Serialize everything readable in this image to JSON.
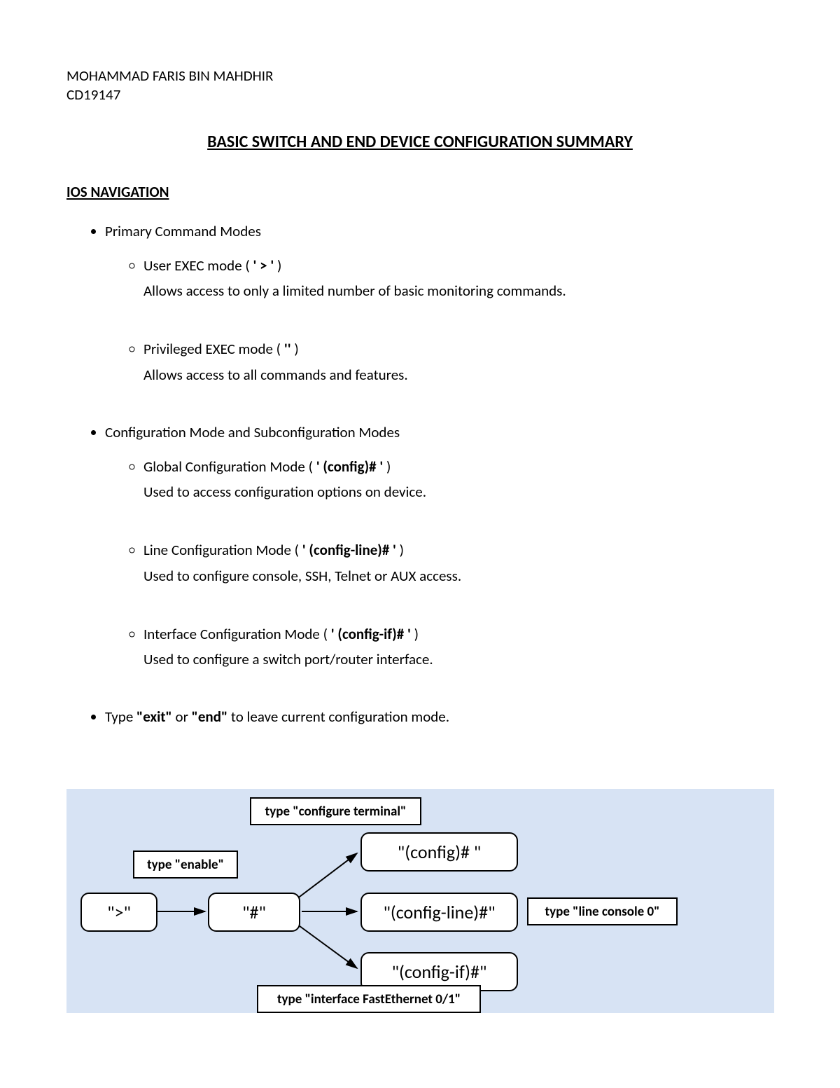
{
  "header": {
    "name": "MOHAMMAD FARIS BIN MAHDHIR",
    "id": "CD19147"
  },
  "title": "BASIC SWITCH AND END DEVICE CONFIGURATION SUMMARY",
  "section_heading": "IOS NAVIGATION",
  "bullets": {
    "primary": {
      "title": "Primary Command Modes",
      "items": [
        {
          "head_pre": "User EXEC mode ( ",
          "head_bold": "' > '",
          "head_post": " )",
          "desc": "Allows access to only a limited number of basic monitoring commands."
        },
        {
          "head_pre": "Privileged EXEC mode ( ",
          "head_bold": "''",
          "head_post": " )",
          "desc": "Allows access to all commands and features."
        }
      ]
    },
    "config": {
      "title": "Configuration Mode and Subconfiguration Modes",
      "items": [
        {
          "head_pre": "Global Configuration Mode ( ",
          "head_bold": "' (config)# '",
          "head_post": " )",
          "desc": "Used to access configuration options on device."
        },
        {
          "head_pre": "Line Configuration Mode ( ",
          "head_bold": "' (config-line)# '",
          "head_post": " )",
          "desc": "Used to configure console, SSH, Telnet or AUX access."
        },
        {
          "head_pre": "Interface Configuration Mode ( ",
          "head_bold": "' (config-if)# '",
          "head_post": " )",
          "desc": "Used to configure a switch port/router interface."
        }
      ]
    },
    "exit": {
      "pre": "Type ",
      "b1": "\"exit\"",
      "mid": " or ",
      "b2": "\"end\"",
      "post": " to leave current configuration mode."
    }
  },
  "diagram": {
    "nodes": {
      "user": "\">\"",
      "priv": "\"#\"",
      "cfg": "\"(config)# \"",
      "line": "\"(config-line)#\"",
      "ifc": "\"(config-if)#\""
    },
    "labels": {
      "enable": "type \"enable\"",
      "conft": "type \"configure terminal\"",
      "linecon": "type \"line console 0\"",
      "intfa": "type \"interface FastEthernet 0/1\""
    }
  }
}
